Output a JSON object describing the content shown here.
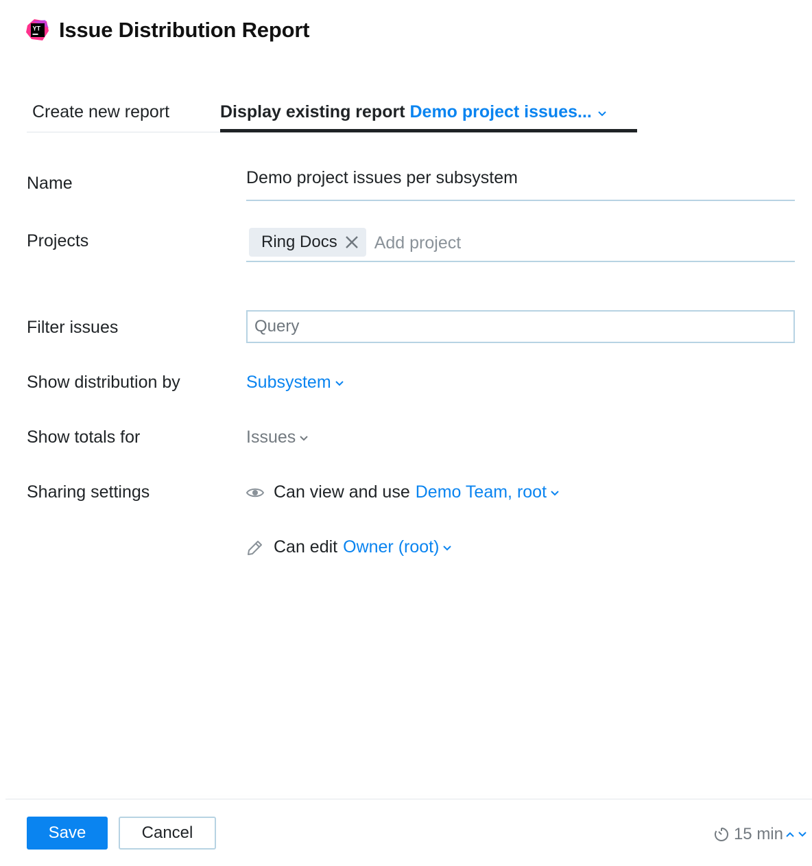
{
  "header": {
    "title": "Issue Distribution Report",
    "logo_text": "YT",
    "logo_icon": "youtrack-logo"
  },
  "tabs": {
    "create_label": "Create new report",
    "display_label": "Display existing report",
    "selected_report": "Demo project issues..."
  },
  "form": {
    "name_label": "Name",
    "name_value": "Demo project issues per subsystem",
    "projects_label": "Projects",
    "projects": [
      "Ring Docs"
    ],
    "add_project_placeholder": "Add project",
    "filter_label": "Filter issues",
    "filter_placeholder": "Query",
    "distribution_label": "Show distribution by",
    "distribution_value": "Subsystem",
    "totals_label": "Show totals for",
    "totals_value": "Issues",
    "sharing_label": "Sharing settings",
    "view_text": "Can view and use",
    "view_value": "Demo Team, root",
    "edit_text": "Can edit",
    "edit_value": "Owner (root)"
  },
  "footer": {
    "save_label": "Save",
    "cancel_label": "Cancel",
    "refresh_interval": "15 min"
  },
  "colors": {
    "accent": "#0a84f0",
    "text": "#1f2326",
    "muted": "#737a80",
    "field_border": "#b7d3e3"
  },
  "icons": {
    "view": "eye-icon",
    "edit": "pencil-icon",
    "remove_chip": "close-icon",
    "timer": "timer-icon",
    "dropdown": "chevron-down-icon"
  }
}
